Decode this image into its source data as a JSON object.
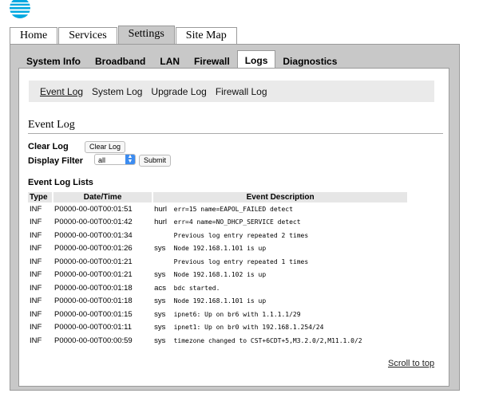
{
  "logo": {
    "name": "att-globe-logo"
  },
  "main_tabs": [
    "Home",
    "Services",
    "Settings",
    "Site Map"
  ],
  "active_main_tab": 2,
  "sub_tabs": [
    "System Info",
    "Broadband",
    "LAN",
    "Firewall",
    "Logs",
    "Diagnostics"
  ],
  "active_sub_tab": 4,
  "log_tabs": [
    "Event Log",
    "System Log",
    "Upgrade Log",
    "Firewall Log"
  ],
  "active_log_tab": 0,
  "section_title": "Event Log",
  "clear_log": {
    "label": "Clear Log",
    "button": "Clear Log"
  },
  "display_filter": {
    "label": "Display Filter",
    "value": "all",
    "submit": "Submit"
  },
  "lists_title": "Event Log Lists",
  "table": {
    "headers": [
      "Type",
      "Date/Time",
      "Event Description"
    ],
    "rows": [
      {
        "type": "INF",
        "datetime": "P0000-00-00T00:01:51",
        "source": "hurl",
        "desc": "err=15 name=EAPOL_FAILED detect"
      },
      {
        "type": "INF",
        "datetime": "P0000-00-00T00:01:42",
        "source": "hurl",
        "desc": "err=4 name=NO_DHCP_SERVICE detect"
      },
      {
        "type": "INF",
        "datetime": "P0000-00-00T00:01:34",
        "source": "",
        "desc": "Previous log entry repeated 2 times"
      },
      {
        "type": "INF",
        "datetime": "P0000-00-00T00:01:26",
        "source": "sys",
        "desc": "Node 192.168.1.101 is up"
      },
      {
        "type": "INF",
        "datetime": "P0000-00-00T00:01:21",
        "source": "",
        "desc": "Previous log entry repeated 1 times"
      },
      {
        "type": "INF",
        "datetime": "P0000-00-00T00:01:21",
        "source": "sys",
        "desc": "Node 192.168.1.102 is up"
      },
      {
        "type": "INF",
        "datetime": "P0000-00-00T00:01:18",
        "source": "acs",
        "desc": "bdc started."
      },
      {
        "type": "INF",
        "datetime": "P0000-00-00T00:01:18",
        "source": "sys",
        "desc": "Node 192.168.1.101 is up"
      },
      {
        "type": "INF",
        "datetime": "P0000-00-00T00:01:15",
        "source": "sys",
        "desc": "ipnet6: Up on br6 with 1.1.1.1/29"
      },
      {
        "type": "INF",
        "datetime": "P0000-00-00T00:01:11",
        "source": "sys",
        "desc": "ipnet1: Up on br0 with 192.168.1.254/24"
      },
      {
        "type": "INF",
        "datetime": "P0000-00-00T00:00:59",
        "source": "sys",
        "desc": "timezone changed to CST+6CDT+5,M3.2.0/2,M11.1.0/2"
      }
    ]
  },
  "scroll_to_top": "Scroll to top",
  "colors": {
    "brand_blue": "#00a8e0",
    "tab_gray": "#c8c8c8",
    "select_blue": "#3c8cf0"
  }
}
